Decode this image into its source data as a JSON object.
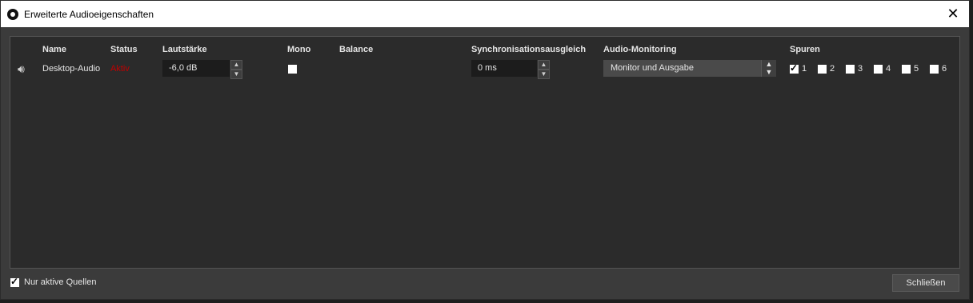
{
  "window": {
    "title": "Erweiterte Audioeigenschaften",
    "close_glyph": "✕"
  },
  "columns": [
    "Name",
    "Status",
    "Lautstärke",
    "Mono",
    "Balance",
    "Synchronisationsausgleich",
    "Audio-Monitoring",
    "Spuren"
  ],
  "source": {
    "name": "Desktop-Audio",
    "status": "Aktiv",
    "volume": "-6,0 dB",
    "mono_checked": false,
    "sync_offset": "0 ms",
    "monitoring": "Monitor und Ausgabe",
    "tracks": [
      {
        "label": "1",
        "checked": true
      },
      {
        "label": "2",
        "checked": false
      },
      {
        "label": "3",
        "checked": false
      },
      {
        "label": "4",
        "checked": false
      },
      {
        "label": "5",
        "checked": false
      },
      {
        "label": "6",
        "checked": false
      }
    ]
  },
  "footer": {
    "only_active_label": "Nur aktive Quellen",
    "only_active_checked": true,
    "close_label": "Schließen"
  },
  "icons": {
    "speaker": "speaker-icon",
    "up": "▲",
    "down": "▼"
  },
  "colors": {
    "status_active": "#c10000",
    "panel_bg": "#2b2b2b",
    "window_bg": "#3b3b3b"
  }
}
